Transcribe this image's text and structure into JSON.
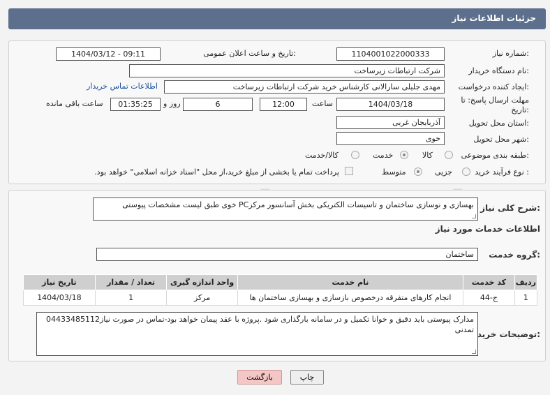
{
  "header": {
    "title": "جزئیات اطلاعات نیاز"
  },
  "form": {
    "need_number_label": "شماره نیاز:",
    "need_number": "1104001022000333",
    "announce_label": "تاریخ و ساعت اعلان عمومی:",
    "announce_value": "1404/03/12 - 09:11",
    "buyer_org_label": "نام دستگاه خریدار:",
    "buyer_org": "شرکت ارتباطات زیرساخت",
    "creator_label": "ایجاد کننده درخواست:",
    "creator": "مهدی جلیلی سارالانی کارشناس خرید شرکت ارتباطات زیرساخت",
    "contact_link": "اطلاعات تماس خریدار",
    "deadline_label_1": "مهلت ارسال پاسخ: تا",
    "deadline_label_2": "تاریخ:",
    "deadline_date": "1404/03/18",
    "time_label": "ساعت",
    "deadline_time": "12:00",
    "days_value": "6",
    "days_label": "روز و",
    "remaining_time": "01:35:25",
    "remaining_label": "ساعت باقی مانده",
    "province_label": "استان محل تحویل:",
    "province": "آذربایجان غربی",
    "city_label": "شهر محل تحویل:",
    "city": "خوی",
    "category_label": "طبقه بندی موضوعی:",
    "category_options": [
      "کالا",
      "خدمت",
      "کالا/خدمت"
    ],
    "purchase_type_label": "نوع فرآیند خرید :",
    "purchase_options": [
      "جزیی",
      "متوسط"
    ],
    "payment_note": "پرداخت تمام یا بخشی از مبلغ خرید،از محل \"اسناد خزانه اسلامی\" خواهد بود."
  },
  "summary": {
    "label": "شرح کلی نیاز:",
    "text": "بهسازی و نوسازی ساختمان و تاسیسات الکتریکی بخش آسانسور مرکزPC خوی طبق لیست مشخصات پیوستی"
  },
  "services": {
    "section_title": "اطلاعات خدمات مورد نیاز",
    "group_label": "گروه خدمت:",
    "group_value": "ساختمان",
    "columns": [
      "ردیف",
      "کد خدمت",
      "نام خدمت",
      "واحد اندازه گیری",
      "تعداد / مقدار",
      "تاریخ نیاز"
    ],
    "rows": [
      [
        "1",
        "ج-44",
        "انجام کارهای متفرقه درخصوص بازسازی و بهسازی ساختمان ها",
        "مرکز",
        "1",
        "1404/03/18"
      ]
    ]
  },
  "notes": {
    "label": "توضیحات خریدار:",
    "text": "مدارک پیوستی باید دقیق و خوانا تکمیل و در سامانه بارگذاری شود .پروژه با عقد پیمان خواهد بود-تماس در صورت نیاز04433485112 تمدنی"
  },
  "buttons": {
    "print": "چاپ",
    "back": "بازگشت"
  },
  "watermark": {
    "text": "AriaTender.neT"
  },
  "colors": {
    "header_bg": "#5c6f8c",
    "link": "#1a4fa0",
    "back_btn": "#f5c6c6"
  }
}
